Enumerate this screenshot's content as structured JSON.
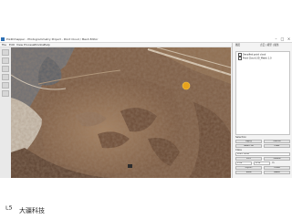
{
  "window": {
    "title": "Pix4Dmapper - Photogrammetry Project - Point Cloud / Mesh Editor",
    "controls": {
      "minimize": "–",
      "maximize": "□",
      "close": "×"
    }
  },
  "menubar": {
    "items": [
      "File",
      "Edit",
      "View",
      "Process",
      "Window",
      "Help"
    ]
  },
  "toolbar": {
    "tools": [
      "select",
      "pan",
      "zoom",
      "rotate",
      "measure",
      "edit"
    ]
  },
  "panel": {
    "header_left": "图层",
    "header_right": "点云 | 模型 | 属性",
    "layer_rows": [
      {
        "label": "Densified point cloud",
        "checked": true
      },
      {
        "label": "Point Cloud (3D_Mesh) 1.0",
        "checked": true
      }
    ],
    "selection_label": "Selection",
    "buttons": {
      "row1_left": "Apply",
      "row1_right": "Cancel",
      "row2_left": "Select all",
      "row2_right": "Clear",
      "row3_left": "Edit",
      "row3_right": "Delete",
      "row4_left": "Export",
      "row4_right": "Close",
      "row5_left": "Save",
      "row5_right": "Reset"
    },
    "fields": {
      "class_label": "Class",
      "class_value": "Point cloud",
      "value_a": "1.00",
      "value_b": "0.50",
      "unit": "m"
    },
    "status": "Ready"
  },
  "viewport": {
    "marker": "orange-circle-marker"
  },
  "watermark": {
    "logo_symbol": "ᴸ⁵",
    "logo_text": "大疆科技"
  },
  "colors": {
    "terrain": "#9b7a5c",
    "terrain_dark": "#6a4e3a",
    "road": "#d9cbb5",
    "water": "#5e6670",
    "marker": "#e7a21c"
  }
}
